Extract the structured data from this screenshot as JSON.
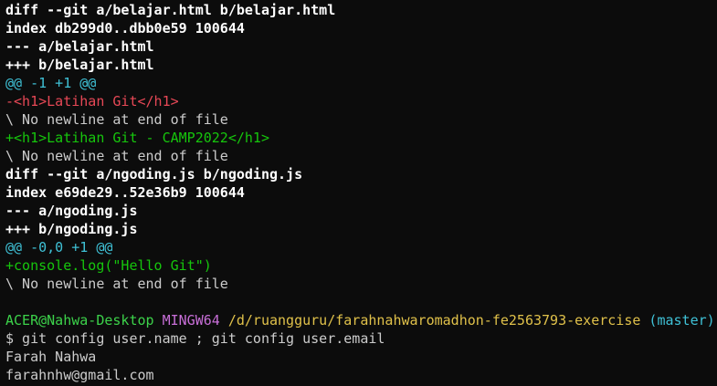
{
  "colors": {
    "background": "#0c0c0c",
    "text": "#cccccc",
    "bold": "#ffffff",
    "hunk": "#3fc1d6",
    "removed": "#e74856",
    "added": "#16c60c",
    "user_host": "#16c60c",
    "mingw": "#c86fd8",
    "path": "#e0c14a",
    "branch": "#3fc1d6"
  },
  "diff_lines": [
    "diff --git a/belajar.html b/belajar.html",
    "index db299d0..dbb0e59 100644",
    "--- a/belajar.html",
    "+++ b/belajar.html",
    "@@ -1 +1 @@",
    "-<h1>Latihan Git</h1>",
    "\\ No newline at end of file",
    "+<h1>Latihan Git - CAMP2022</h1>",
    "\\ No newline at end of file",
    "diff --git a/ngoding.js b/ngoding.js",
    "index e69de29..52e36b9 100644",
    "--- a/ngoding.js",
    "+++ b/ngoding.js",
    "@@ -0,0 +1 @@",
    "+console.log(\"Hello Git\")",
    "\\ No newline at end of file"
  ],
  "prompt": {
    "user_host": "ACER@Nahwa-Desktop",
    "shell": "MINGW64",
    "path": "/d/ruangguru/farahnahwaromadhon-fe2563793-exercise",
    "branch": "(master)"
  },
  "command": "$ git config user.name ; git config user.email",
  "output": [
    "Farah Nahwa",
    "farahnhw@gmail.com"
  ]
}
